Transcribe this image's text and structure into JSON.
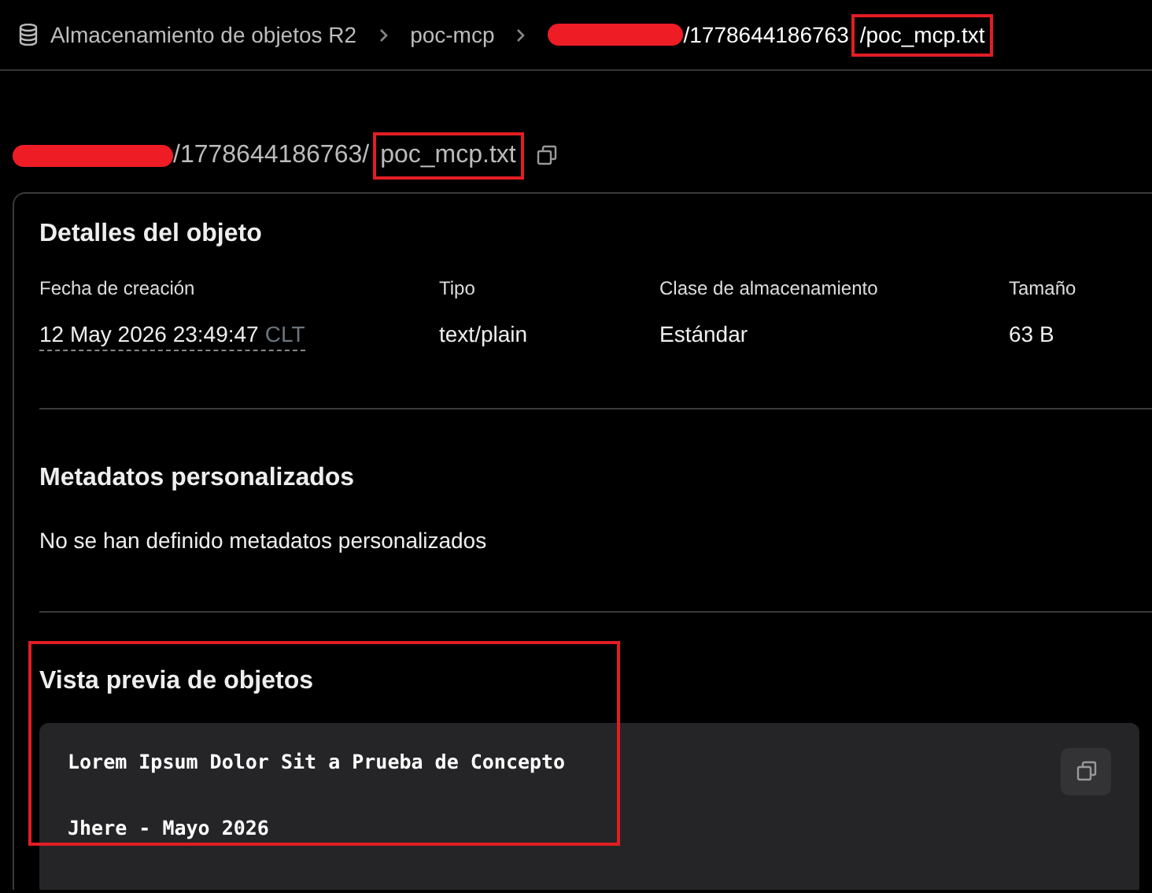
{
  "breadcrumb": {
    "items": [
      {
        "kind": "root",
        "text": "Almacenamiento de objetos R2"
      },
      {
        "kind": "link",
        "text": "poc-mcp"
      },
      {
        "kind": "path",
        "segments": [
          {
            "kind": "redacted"
          },
          {
            "kind": "text",
            "text": "/1778644186763",
            "highlighted": false
          },
          {
            "kind": "text",
            "text": "/poc_mcp.txt",
            "highlighted": true
          }
        ]
      }
    ]
  },
  "title": {
    "segments": [
      {
        "kind": "redacted"
      },
      {
        "kind": "text",
        "text": "/1778644186763/",
        "highlighted": false
      },
      {
        "kind": "text",
        "text": "poc_mcp.txt",
        "highlighted": true
      }
    ]
  },
  "details": {
    "heading": "Detalles del objeto",
    "fields": [
      {
        "label": "Fecha de creación",
        "value": "12 May 2026 23:49:47",
        "suffix": "CLT"
      },
      {
        "label": "Tipo",
        "value": "text/plain"
      },
      {
        "label": "Clase de almacenamiento",
        "value": "Estándar"
      },
      {
        "label": "Tamaño",
        "value": "63 B"
      }
    ]
  },
  "metadata": {
    "heading": "Metadatos personalizados",
    "message": "No se han definido metadatos personalizados"
  },
  "preview": {
    "heading": "Vista previa de objetos",
    "highlighted": true,
    "lines": [
      "Lorem Ipsum Dolor Sit a Prueba de Concepto",
      "Jhere - Mayo 2026"
    ]
  }
}
